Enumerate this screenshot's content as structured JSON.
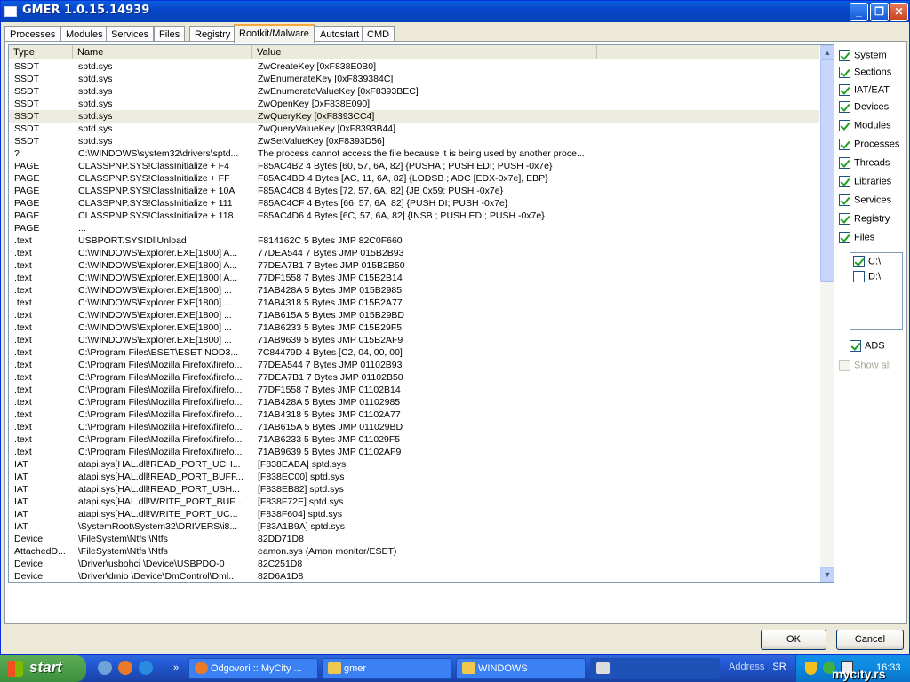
{
  "window": {
    "title": "GMER 1.0.15.14939",
    "controls": [
      "_",
      "❐",
      "✕"
    ]
  },
  "tabs": [
    {
      "label": "Processes",
      "active": false
    },
    {
      "label": "Modules",
      "active": false
    },
    {
      "label": "Services",
      "active": false
    },
    {
      "label": "Files",
      "active": false
    },
    {
      "label": "Registry",
      "active": false
    },
    {
      "label": "Rootkit/Malware",
      "active": true
    },
    {
      "label": "Autostart",
      "active": false
    },
    {
      "label": "CMD",
      "active": false
    }
  ],
  "table": {
    "columns": [
      "Type",
      "Name",
      "Value"
    ],
    "selected_row": 4,
    "rows": [
      [
        "SSDT",
        "sptd.sys",
        "ZwCreateKey [0xF838E0B0]"
      ],
      [
        "SSDT",
        "sptd.sys",
        "ZwEnumerateKey [0xF839384C]"
      ],
      [
        "SSDT",
        "sptd.sys",
        "ZwEnumerateValueKey [0xF8393BEC]"
      ],
      [
        "SSDT",
        "sptd.sys",
        "ZwOpenKey [0xF838E090]"
      ],
      [
        "SSDT",
        "sptd.sys",
        "ZwQueryKey [0xF8393CC4]"
      ],
      [
        "SSDT",
        "sptd.sys",
        "ZwQueryValueKey [0xF8393B44]"
      ],
      [
        "SSDT",
        "sptd.sys",
        "ZwSetValueKey [0xF8393D56]"
      ],
      [
        "?",
        "C:\\WINDOWS\\system32\\drivers\\sptd...",
        "The process cannot access the file because it is being used by another proce..."
      ],
      [
        "PAGE",
        "CLASSPNP.SYS!ClassInitialize + F4",
        "F85AC4B2 4 Bytes  [60, 57, 6A, 82] {PUSHA ; PUSH EDI; PUSH -0x7e}"
      ],
      [
        "PAGE",
        "CLASSPNP.SYS!ClassInitialize + FF",
        "F85AC4BD 4 Bytes  [AC, 11, 6A, 82] {LODSB ; ADC [EDX-0x7e], EBP}"
      ],
      [
        "PAGE",
        "CLASSPNP.SYS!ClassInitialize + 10A",
        "F85AC4C8 4 Bytes  [72, 57, 6A, 82] {JB 0x59; PUSH -0x7e}"
      ],
      [
        "PAGE",
        "CLASSPNP.SYS!ClassInitialize + 111",
        "F85AC4CF 4 Bytes  [66, 57, 6A, 82] {PUSH DI; PUSH -0x7e}"
      ],
      [
        "PAGE",
        "CLASSPNP.SYS!ClassInitialize + 118",
        "F85AC4D6 4 Bytes  [6C, 57, 6A, 82] {INSB ; PUSH EDI; PUSH -0x7e}"
      ],
      [
        "PAGE",
        "...",
        ""
      ],
      [
        ".text",
        "USBPORT.SYS!DllUnload",
        "F814162C 5 Bytes  JMP 82C0F660"
      ],
      [
        ".text",
        "C:\\WINDOWS\\Explorer.EXE[1800] A...",
        "77DEA544 7 Bytes  JMP 015B2B93"
      ],
      [
        ".text",
        "C:\\WINDOWS\\Explorer.EXE[1800] A...",
        "77DEA7B1 7 Bytes  JMP 015B2B50"
      ],
      [
        ".text",
        "C:\\WINDOWS\\Explorer.EXE[1800] A...",
        "77DF1558 7 Bytes  JMP 015B2B14"
      ],
      [
        ".text",
        "C:\\WINDOWS\\Explorer.EXE[1800] ...",
        "71AB428A 5 Bytes  JMP 015B2985"
      ],
      [
        ".text",
        "C:\\WINDOWS\\Explorer.EXE[1800] ...",
        "71AB4318 5 Bytes  JMP 015B2A77"
      ],
      [
        ".text",
        "C:\\WINDOWS\\Explorer.EXE[1800] ...",
        "71AB615A 5 Bytes  JMP 015B29BD"
      ],
      [
        ".text",
        "C:\\WINDOWS\\Explorer.EXE[1800] ...",
        "71AB6233 5 Bytes  JMP 015B29F5"
      ],
      [
        ".text",
        "C:\\WINDOWS\\Explorer.EXE[1800] ...",
        "71AB9639 5 Bytes  JMP 015B2AF9"
      ],
      [
        ".text",
        "C:\\Program Files\\ESET\\ESET NOD3...",
        "7C84479D 4 Bytes  [C2, 04, 00, 00]"
      ],
      [
        ".text",
        "C:\\Program Files\\Mozilla Firefox\\firefo...",
        "77DEA544 7 Bytes  JMP 01102B93"
      ],
      [
        ".text",
        "C:\\Program Files\\Mozilla Firefox\\firefo...",
        "77DEA7B1 7 Bytes  JMP 01102B50"
      ],
      [
        ".text",
        "C:\\Program Files\\Mozilla Firefox\\firefo...",
        "77DF1558 7 Bytes  JMP 01102B14"
      ],
      [
        ".text",
        "C:\\Program Files\\Mozilla Firefox\\firefo...",
        "71AB428A 5 Bytes  JMP 01102985"
      ],
      [
        ".text",
        "C:\\Program Files\\Mozilla Firefox\\firefo...",
        "71AB4318 5 Bytes  JMP 01102A77"
      ],
      [
        ".text",
        "C:\\Program Files\\Mozilla Firefox\\firefo...",
        "71AB615A 5 Bytes  JMP 011029BD"
      ],
      [
        ".text",
        "C:\\Program Files\\Mozilla Firefox\\firefo...",
        "71AB6233 5 Bytes  JMP 011029F5"
      ],
      [
        ".text",
        "C:\\Program Files\\Mozilla Firefox\\firefo...",
        "71AB9639 5 Bytes  JMP 01102AF9"
      ],
      [
        "IAT",
        "atapi.sys[HAL.dll!READ_PORT_UCH...",
        "[F838EABA] sptd.sys"
      ],
      [
        "IAT",
        "atapi.sys[HAL.dll!READ_PORT_BUFF...",
        "[F838EC00] sptd.sys"
      ],
      [
        "IAT",
        "atapi.sys[HAL.dll!READ_PORT_USH...",
        "[F838EB82] sptd.sys"
      ],
      [
        "IAT",
        "atapi.sys[HAL.dll!WRITE_PORT_BUF...",
        "[F838F72E] sptd.sys"
      ],
      [
        "IAT",
        "atapi.sys[HAL.dll!WRITE_PORT_UC...",
        "[F838F604] sptd.sys"
      ],
      [
        "IAT",
        "\\SystemRoot\\System32\\DRIVERS\\i8...",
        "[F83A1B9A] sptd.sys"
      ],
      [
        "Device",
        "\\FileSystem\\Ntfs \\Ntfs",
        "82DD71D8"
      ],
      [
        "AttachedD...",
        "\\FileSystem\\Ntfs \\Ntfs",
        "eamon.sys (Amon monitor/ESET)"
      ],
      [
        "Device",
        "\\Driver\\usbohci \\Device\\USBPDO-0",
        "82C251D8"
      ],
      [
        "Device",
        "\\Driver\\dmio \\Device\\DmControl\\Dml...",
        "82D6A1D8"
      ]
    ]
  },
  "options": [
    {
      "label": "System",
      "checked": true
    },
    {
      "label": "Sections",
      "checked": true
    },
    {
      "label": "IAT/EAT",
      "checked": true
    },
    {
      "label": "Devices",
      "checked": true
    },
    {
      "label": "Modules",
      "checked": true
    },
    {
      "label": "Processes",
      "checked": true
    },
    {
      "label": "Threads",
      "checked": true
    },
    {
      "label": "Libraries",
      "checked": true
    },
    {
      "label": "Services",
      "checked": true
    },
    {
      "label": "Registry",
      "checked": true
    },
    {
      "label": "Files",
      "checked": true
    }
  ],
  "drives": [
    {
      "label": "C:\\",
      "checked": true
    },
    {
      "label": "D:\\",
      "checked": false
    }
  ],
  "ads": {
    "label": "ADS",
    "checked": true
  },
  "show_all": {
    "label": "Show all",
    "checked": false,
    "disabled": true
  },
  "buttons": {
    "ok": "OK",
    "cancel": "Cancel"
  },
  "taskbar": {
    "start": "start",
    "tasks": [
      {
        "label": "Odgovori :: MyCity ...",
        "active": false
      },
      {
        "label": "gmer",
        "active": false
      },
      {
        "label": "WINDOWS",
        "active": false
      },
      {
        "label": "",
        "active": true
      }
    ],
    "address_label": "Address",
    "language": "SR",
    "clock": "16:33",
    "watermark": "mycity.rs"
  },
  "colors": {
    "accent": "#f8a838",
    "title_bar": "#0846c8",
    "selected_row": "#eeebe0"
  }
}
